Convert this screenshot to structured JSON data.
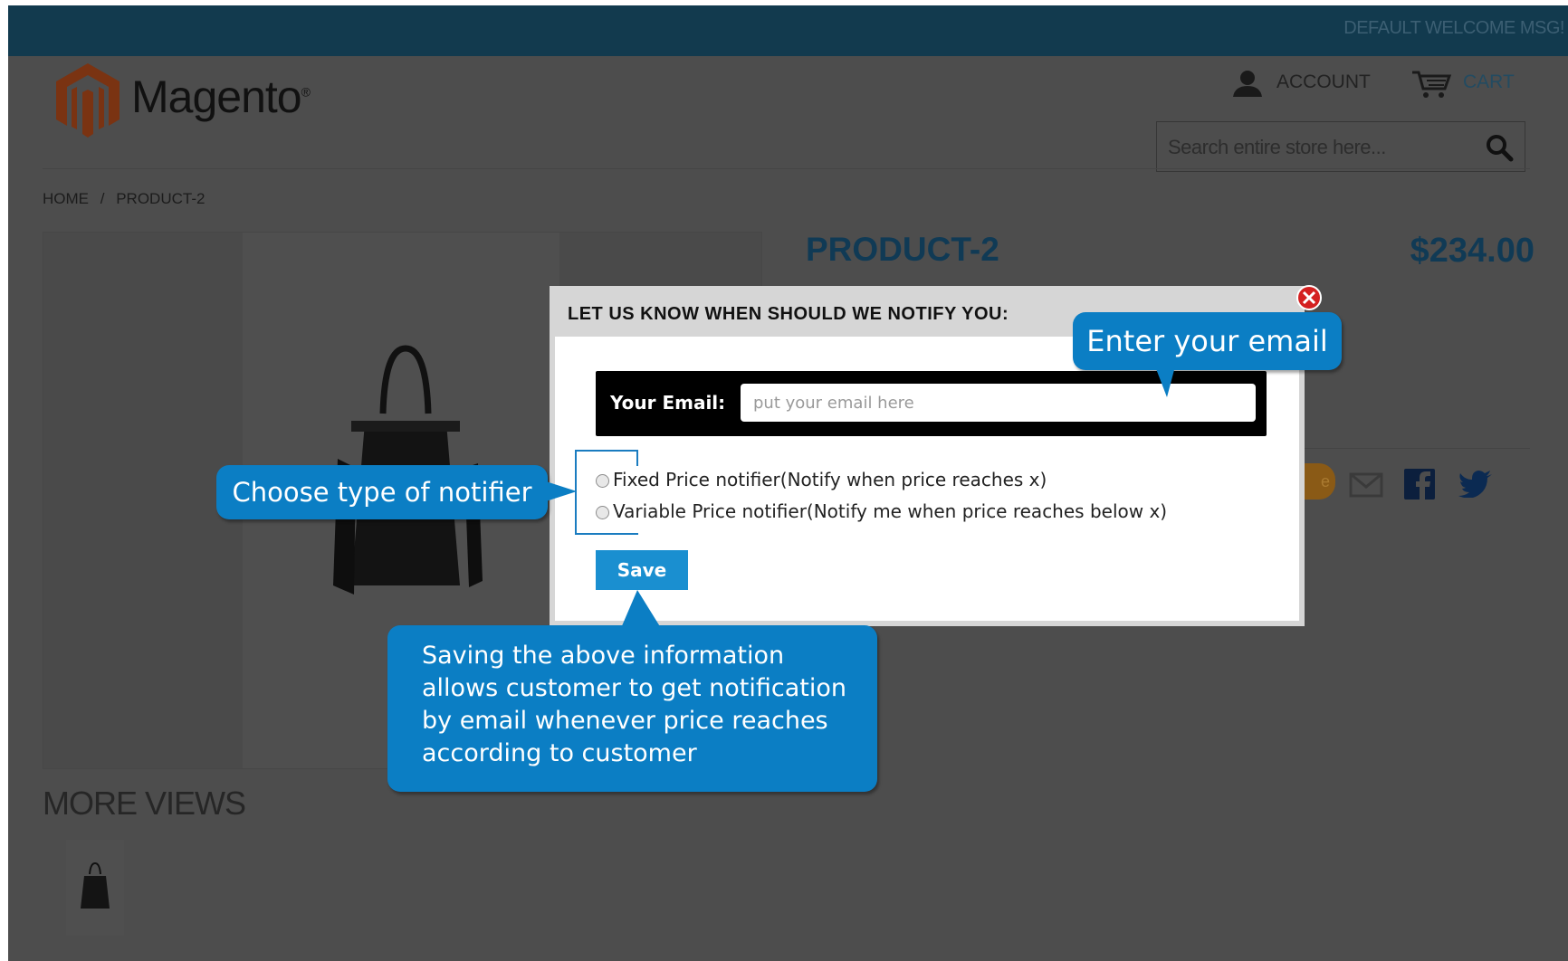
{
  "header": {
    "welcome_msg": "DEFAULT WELCOME MSG!",
    "logo_text": "Magento",
    "logo_mark": "®",
    "account_label": "ACCOUNT",
    "cart_label": "CART",
    "search_placeholder": "Search entire store here..."
  },
  "breadcrumb": {
    "home": "HOME",
    "separator": "/",
    "current": "PRODUCT-2"
  },
  "product": {
    "name": "PRODUCT-2",
    "price": "$234.00",
    "more_views_label": "MORE VIEWS"
  },
  "modal": {
    "title": "LET US KNOW WHEN SHOULD WE NOTIFY YOU:",
    "email_label": "Your Email:",
    "email_placeholder": "put your email here",
    "radio_fixed": "Fixed Price notifier(Notify when price reaches x)",
    "radio_variable": "Variable Price notifier(Notify me when price reaches below x)",
    "save_label": "Save"
  },
  "callouts": {
    "email": "Enter your email",
    "notifier": "Choose type of notifier",
    "save": "Saving the above information\nallows customer to get notification\nby email whenever price reaches\naccording to customer"
  },
  "colors": {
    "topbar": "#123a4e",
    "overlay": "#4d4d4d",
    "callout": "#0b7ec4",
    "save_button": "#1a8fd0"
  },
  "icons": [
    "account-icon",
    "cart-icon",
    "search-icon",
    "close-icon",
    "email-share-icon",
    "facebook-icon",
    "twitter-icon"
  ]
}
